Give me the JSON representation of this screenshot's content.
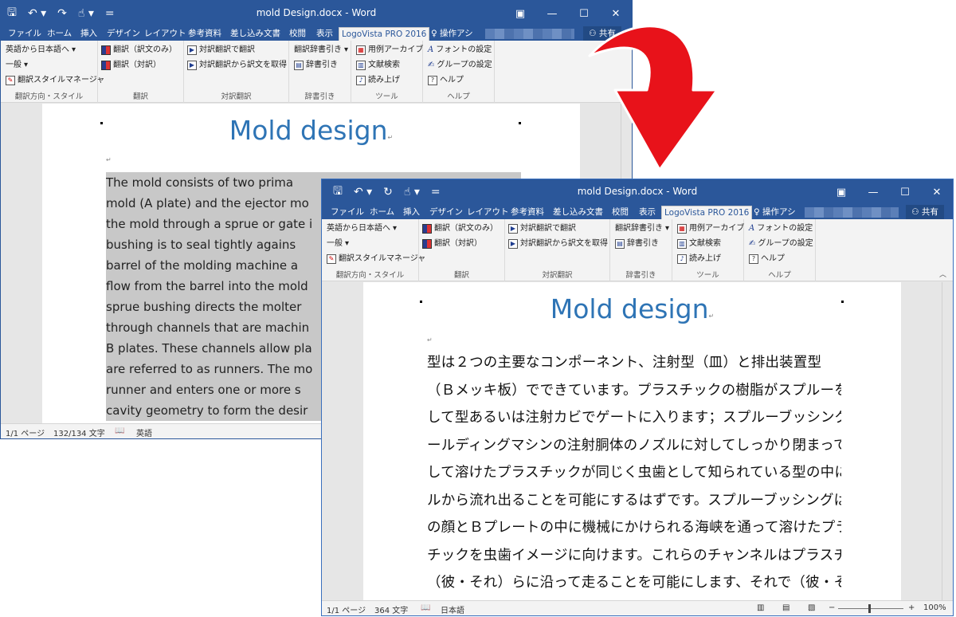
{
  "window_back": {
    "title": "mold Design.docx - Word",
    "tabs": [
      "ファイル",
      "ホーム",
      "挿入",
      "デザイン",
      "レイアウト",
      "参考資料",
      "差し込み文書",
      "校閲",
      "表示",
      "LogoVista PRO 2016"
    ],
    "tell_me": "操作アシ",
    "share": "共有",
    "ribbon": {
      "translation_direction": {
        "items": [
          "英語から日本語へ",
          "一般",
          "翻訳スタイルマネージャ"
        ],
        "label": "翻訳方向・スタイル"
      },
      "translate": {
        "items": [
          "翻訳（訳文のみ）",
          "翻訳（対訳）"
        ],
        "label": "翻訳"
      },
      "parallel": {
        "items": [
          "対訳翻訳で翻訳",
          "対訳翻訳から訳文を取得"
        ],
        "label": "対訳翻訳"
      },
      "dictionary": {
        "items": [
          "翻訳辞書引き",
          "辞書引き"
        ],
        "label": "辞書引き"
      },
      "tools": {
        "items": [
          "用例アーカイブ",
          "文献検索",
          "読み上げ"
        ],
        "label": "ツール"
      },
      "help": {
        "items": [
          "フォントの設定",
          "グループの設定",
          "ヘルプ"
        ],
        "label": "ヘルプ"
      }
    },
    "heading": "Mold design",
    "body_lines": [
      "The mold consists of two prima",
      "mold (A plate) and the ejector mo",
      "the mold through a sprue or gate i",
      "bushing is to seal tightly agains",
      "barrel of the molding machine a",
      "flow from the barrel into the mold",
      "sprue bushing directs the molter",
      "through channels that are machin",
      "B plates. These channels allow pla",
      "are referred to as runners. The mo",
      "runner and enters one or more s",
      "cavity geometry to form the desir"
    ],
    "status": {
      "page": "1/1 ページ",
      "words": "132/134 文字",
      "language": "英語"
    }
  },
  "window_front": {
    "title": "mold Design.docx - Word",
    "tabs": [
      "ファイル",
      "ホーム",
      "挿入",
      "デザイン",
      "レイアウト",
      "参考資料",
      "差し込み文書",
      "校閲",
      "表示",
      "LogoVista PRO 2016"
    ],
    "tell_me": "操作アシ",
    "share": "共有",
    "heading": "Mold design",
    "body_lines": [
      "型は２つの主要なコンポーネント、注射型（皿）と排出装置型",
      "（Ｂメッキ板）でできています。プラスチックの樹脂がスプルーを通",
      "して型あるいは注射カビでゲートに入ります；スプルーブッシングはモ",
      "ールディングマシンの注射胴体のノズルに対してしっかり閉まって、そ",
      "して溶けたプラスチックが同じく虫歯として知られている型の中にバレ",
      "ルから流れ出ることを可能にするはずです。スプルーブッシングはＡ",
      "の顔とＢプレートの中に機械にかけられる海峡を通って溶けたプラス",
      "チックを虫歯イメージに向けます。これらのチャンネルはプラスチックが",
      "（彼・それ）らに沿って走ることを可能にします、それで（彼・それ）"
    ],
    "status": {
      "page": "1/1 ページ",
      "words": "364 文字",
      "language": "日本語",
      "zoom": "100%"
    }
  },
  "colors": {
    "title_bar": "#2b579a",
    "heading": "#2e74b5",
    "arrow": "#e8121a",
    "highlight": "#c8c8c8"
  }
}
